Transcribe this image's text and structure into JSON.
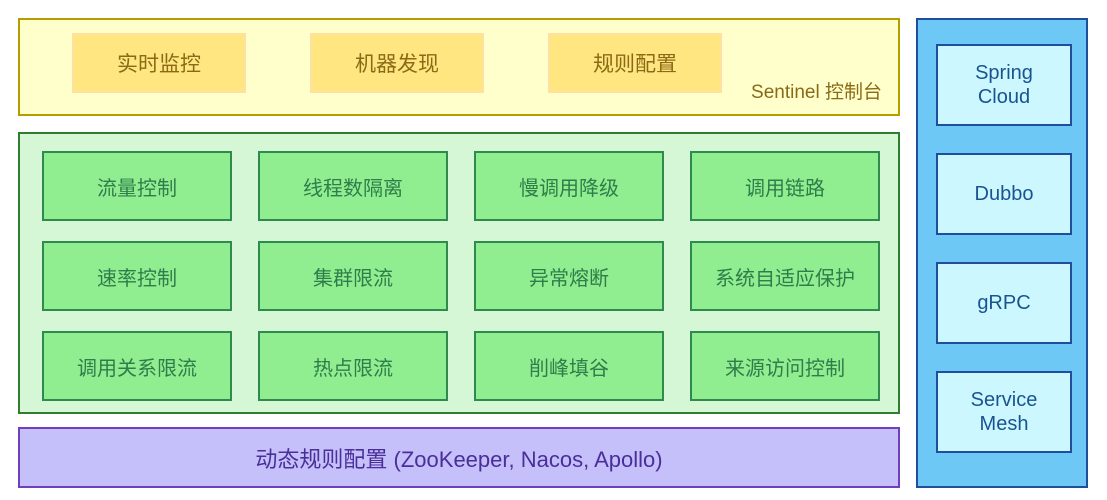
{
  "diagram": {
    "title": "Sentinel architecture overview",
    "colors": {
      "console_panel_bg": "#ffffcc",
      "console_panel_border": "#b3a000",
      "console_box_bg": "#ffe680",
      "console_text": "#8a6a16",
      "core_panel_bg": "#d5f7d5",
      "core_panel_border": "#2f7d2f",
      "core_box_bg": "#90ee90",
      "core_text": "#2e7d4a",
      "datasource_bg": "#c5c0fa",
      "datasource_border": "#6f3fc0",
      "datasource_text": "#4a2e99",
      "adapter_panel_bg": "#6ec8f5",
      "adapter_panel_border": "#1f4f9c",
      "adapter_box_bg": "#ccf7ff",
      "adapter_text": "#1a5490"
    }
  },
  "console": {
    "label": "Sentinel 控制台",
    "boxes": [
      {
        "label": "实时监控"
      },
      {
        "label": "机器发现"
      },
      {
        "label": "规则配置"
      }
    ]
  },
  "core": {
    "boxes": [
      {
        "label": "流量控制"
      },
      {
        "label": "线程数隔离"
      },
      {
        "label": "慢调用降级"
      },
      {
        "label": "调用链路"
      },
      {
        "label": "速率控制"
      },
      {
        "label": "集群限流"
      },
      {
        "label": "异常熔断"
      },
      {
        "label": "系统自适应保护"
      },
      {
        "label": "调用关系限流"
      },
      {
        "label": "热点限流"
      },
      {
        "label": "削峰填谷"
      },
      {
        "label": "来源访问控制"
      }
    ]
  },
  "datasource": {
    "label": "动态规则配置 (ZooKeeper, Nacos, Apollo)"
  },
  "adapters": {
    "boxes": [
      {
        "label": "Spring\nCloud"
      },
      {
        "label": "Dubbo"
      },
      {
        "label": "gRPC"
      },
      {
        "label": "Service\nMesh"
      }
    ]
  }
}
